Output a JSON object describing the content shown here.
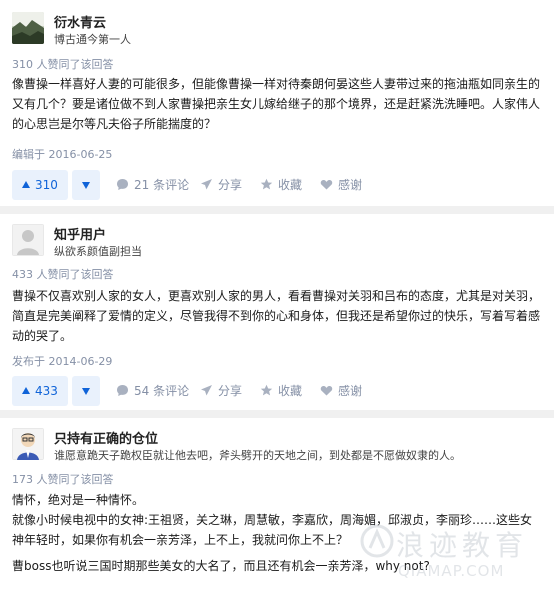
{
  "answers": [
    {
      "author_name": "衍水青云",
      "author_bio": "博古通今第一人",
      "votes_line": "310 人赞同了该回答",
      "content": [
        "像曹操一样喜好人妻的可能很多，但能像曹操一样对待秦朗何晏这些人妻带过来的拖油瓶如同亲生的又有几个？要是诸位做不到人家曹操把亲生女儿嫁给继子的那个境界，还是赶紧洗洗睡吧。人家伟人的心思岂是尔等凡夫俗子所能揣度的？"
      ],
      "edited": "编辑于 2016-06-25",
      "vote_count": "310",
      "comments": "21 条评论",
      "share": "分享",
      "favorite": "收藏",
      "thanks": "感谢"
    },
    {
      "author_name": "知乎用户",
      "author_bio": "纵欲系颜值副担当",
      "votes_line": "433 人赞同了该回答",
      "content": [
        "曹操不仅喜欢别人家的女人，更喜欢别人家的男人，看看曹操对关羽和吕布的态度，尤其是对关羽，简直是完美阐释了爱情的定义，尽管我得不到你的心和身体，但我还是希望你过的快乐，写着写着感动的哭了。"
      ],
      "edited": "发布于 2014-06-29",
      "vote_count": "433",
      "comments": "54 条评论",
      "share": "分享",
      "favorite": "收藏",
      "thanks": "感谢"
    },
    {
      "author_name": "只持有正确的仓位",
      "author_bio": "谁愿意跪天子跪权臣就让他去吧，斧头劈开的天地之间，到处都是不愿做奴隶的人。",
      "votes_line": "173 人赞同了该回答",
      "content": [
        "情怀，绝对是一种情怀。",
        "就像小时候电视中的女神:王祖贤，关之琳，周慧敏，李嘉欣，周海媚，邱淑贞，李丽珍……这些女神年轻时，如果你有机会一亲芳泽，上不上，我就问你上不上？",
        "曹boss也听说三国时期那些美女的大名了，而且还有机会一亲芳泽，why not?"
      ]
    }
  ],
  "watermark": {
    "line1": "浪迹教育",
    "line2": "QIAMAP.COM"
  },
  "colors": {
    "accent": "#0f63d8",
    "vote_bg": "#e9f1fc",
    "meta_gray": "#8590a6",
    "divider": "#f0f0f0"
  }
}
